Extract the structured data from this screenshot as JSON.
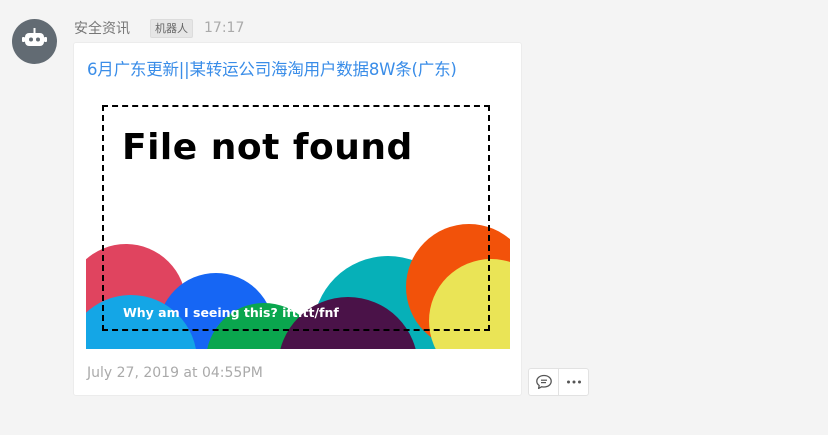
{
  "message": {
    "sender": "安全资讯",
    "badge": "机器人",
    "time": "17:17"
  },
  "card": {
    "title": "6月广东更新||某转运公司海淘用户数据8W条(广东)",
    "image": {
      "heading": "File not found",
      "link_text": "Why am I seeing this? ift.tt/fnf",
      "colors": [
        "#e0445f",
        "#1666f4",
        "#14a6e6",
        "#0aa64e",
        "#4a1248",
        "#06b0b8",
        "#f2520a",
        "#eae456"
      ]
    },
    "date": "July 27, 2019 at 04:55PM"
  },
  "actions": {
    "icons": [
      "comment-icon",
      "more-icon"
    ]
  }
}
